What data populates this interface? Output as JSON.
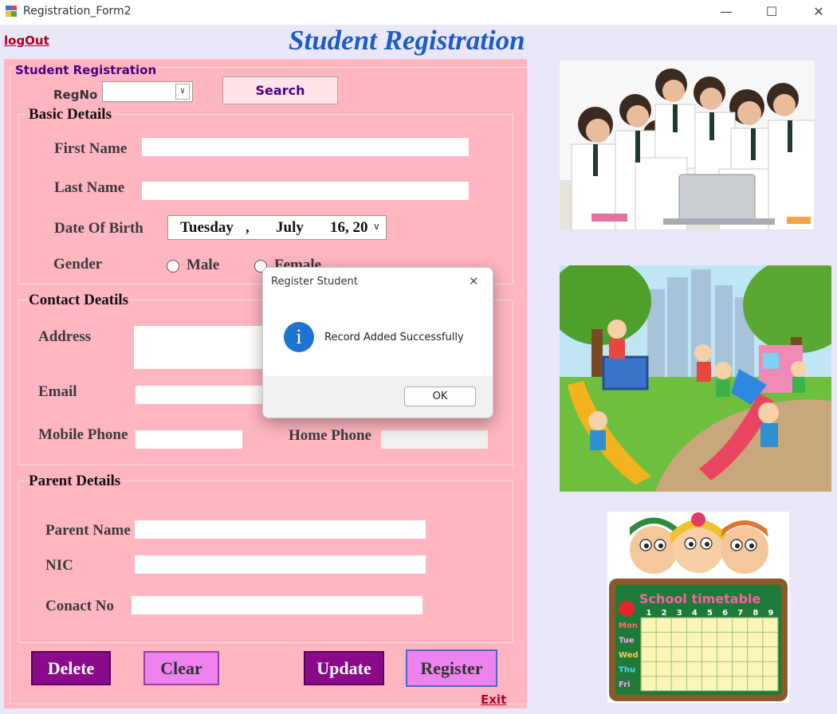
{
  "window": {
    "title": "Registration_Form2",
    "minimize": "—",
    "maximize": "☐",
    "close": "✕"
  },
  "header": {
    "logout": "logOut",
    "title": "Student Registration"
  },
  "form": {
    "group_title": "Student Registration",
    "regno_label": "RegNo",
    "search_button": "Search",
    "basic": {
      "title": "Basic Details",
      "first_name": "First Name",
      "last_name": "Last Name",
      "dob_label": "Date Of Birth",
      "dob": {
        "day": "Tuesday",
        "sep": ",",
        "month": "July",
        "date": "16, 20"
      },
      "gender": "Gender",
      "male": "Male",
      "female": "Female"
    },
    "contact": {
      "title": "Contact Deatils",
      "address": "Address",
      "email": "Email",
      "mobile": "Mobile Phone",
      "home": "Home Phone"
    },
    "parent": {
      "title": "Parent Details",
      "name": "Parent Name",
      "nic": "NIC",
      "contact": "Conact No"
    },
    "buttons": {
      "delete": "Delete",
      "clear": "Clear",
      "update": "Update",
      "register": "Register",
      "exit": "Exit"
    }
  },
  "dialog": {
    "title": "Register Student",
    "close": "✕",
    "icon_glyph": "i",
    "message": "Record Added Successfully",
    "ok": "OK"
  },
  "images": {
    "timetable_title": "School timetable",
    "timetable_cols": [
      "1",
      "2",
      "3",
      "4",
      "5",
      "6",
      "7",
      "8",
      "9"
    ],
    "timetable_rows": [
      "Mon",
      "Tue",
      "Wed",
      "Thu",
      "Fri"
    ]
  }
}
